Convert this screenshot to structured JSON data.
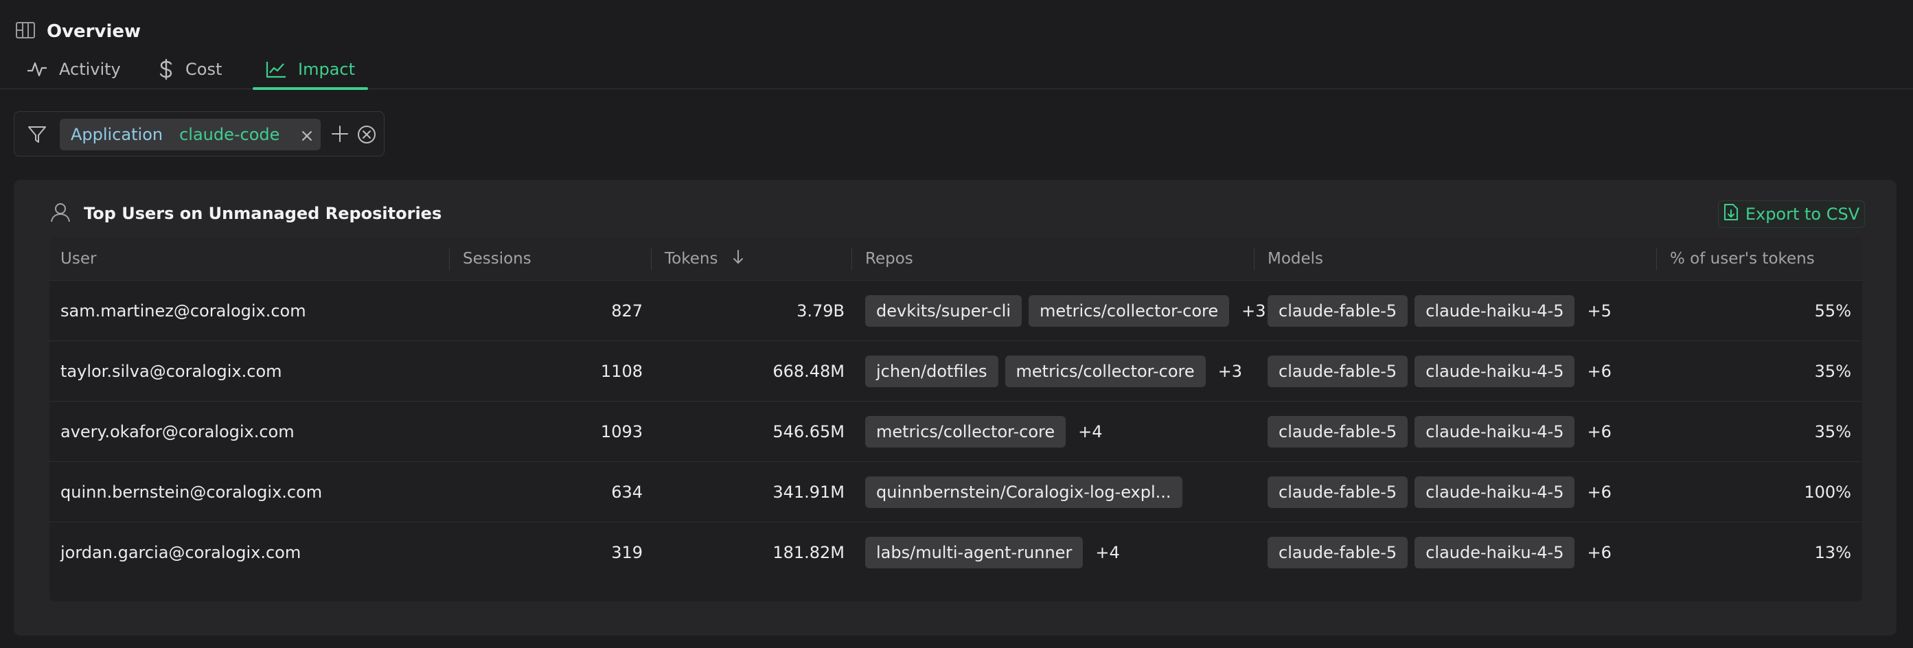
{
  "header": {
    "title": "Overview",
    "icon": "panel-icon"
  },
  "tabs": [
    {
      "label": "Activity",
      "icon": "activity-icon",
      "active": false
    },
    {
      "label": "Cost",
      "icon": "dollar-icon",
      "active": false
    },
    {
      "label": "Impact",
      "icon": "chart-line-icon",
      "active": true
    }
  ],
  "filters": [
    {
      "key": "Application",
      "value": "claude-code"
    }
  ],
  "panel": {
    "title": "Top Users on Unmanaged Repositories",
    "export_label": "Export to CSV"
  },
  "table": {
    "columns": [
      "User",
      "Sessions",
      "Tokens",
      "Repos",
      "Models",
      "% of user's tokens"
    ],
    "sort": {
      "column": "Tokens",
      "direction": "desc"
    },
    "rows": [
      {
        "user": "sam.martinez@coralogix.com",
        "sessions": "827",
        "tokens": "3.79B",
        "repos": [
          "devkits/super-cli",
          "metrics/collector-core"
        ],
        "repos_more": "+3",
        "models": [
          "claude-fable-5",
          "claude-haiku-4-5"
        ],
        "models_more": "+5",
        "pct": "55%"
      },
      {
        "user": "taylor.silva@coralogix.com",
        "sessions": "1108",
        "tokens": "668.48M",
        "repos": [
          "jchen/dotfiles",
          "metrics/collector-core"
        ],
        "repos_more": "+3",
        "models": [
          "claude-fable-5",
          "claude-haiku-4-5"
        ],
        "models_more": "+6",
        "pct": "35%"
      },
      {
        "user": "avery.okafor@coralogix.com",
        "sessions": "1093",
        "tokens": "546.65M",
        "repos": [
          "metrics/collector-core"
        ],
        "repos_more": "+4",
        "models": [
          "claude-fable-5",
          "claude-haiku-4-5"
        ],
        "models_more": "+6",
        "pct": "35%"
      },
      {
        "user": "quinn.bernstein@coralogix.com",
        "sessions": "634",
        "tokens": "341.91M",
        "repos": [
          "quinnbernstein/Coralogix-log-expl..."
        ],
        "repos_more": "",
        "models": [
          "claude-fable-5",
          "claude-haiku-4-5"
        ],
        "models_more": "+6",
        "pct": "100%"
      },
      {
        "user": "jordan.garcia@coralogix.com",
        "sessions": "319",
        "tokens": "181.82M",
        "repos": [
          "labs/multi-agent-runner"
        ],
        "repos_more": "+4",
        "models": [
          "claude-fable-5",
          "claude-haiku-4-5"
        ],
        "models_more": "+6",
        "pct": "13%"
      }
    ]
  },
  "colors": {
    "accent": "#3ecf8e",
    "filter_key": "#8ecbe6",
    "background": "#1c1c1e"
  }
}
